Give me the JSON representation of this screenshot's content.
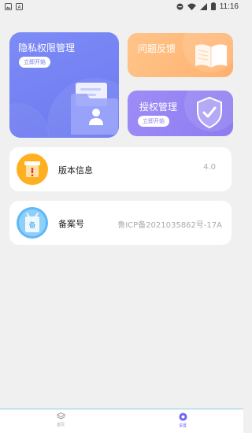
{
  "status_bar": {
    "time": "11:16",
    "left_icons": [
      "image-icon",
      "a-icon"
    ],
    "right_icons": [
      "minus-circle-icon",
      "wifi-icon",
      "signal-icon",
      "battery-icon"
    ]
  },
  "cards": {
    "privacy": {
      "title": "隐私权限管理",
      "button": "立即开始",
      "color": "#7482f3"
    },
    "feedback": {
      "title": "问题反馈",
      "color": "#ffb97a"
    },
    "auth": {
      "title": "授权管理",
      "button": "立即开始",
      "color": "#9483f4"
    }
  },
  "list": {
    "version": {
      "label": "版本信息",
      "value": "4.0"
    },
    "record": {
      "label": "备案号",
      "value": "鲁ICP备2021035862号-17A"
    }
  },
  "bottom_nav": {
    "items": [
      {
        "label": "首页",
        "icon": "layers-icon",
        "active": false
      },
      {
        "label": "设置",
        "icon": "gear-icon",
        "active": true
      }
    ],
    "active_color": "#6c63ff"
  }
}
